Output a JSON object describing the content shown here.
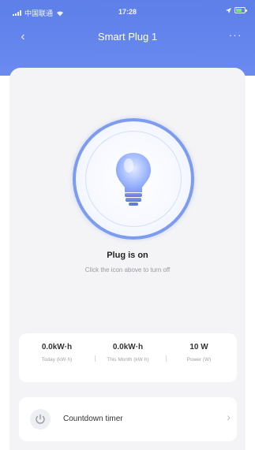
{
  "status_bar": {
    "carrier": "中国联通",
    "time": "17:28"
  },
  "nav": {
    "back_glyph": "‹",
    "title": "Smart Plug 1",
    "more_glyph": "···"
  },
  "device": {
    "status_text": "Plug is on",
    "hint_text": "Click the icon above to turn off",
    "icon": "light-bulb-icon",
    "accent_color": "#7d9cf0"
  },
  "stats": [
    {
      "value": "0.0kW·h",
      "label": "Today (kW·h)"
    },
    {
      "value": "0.0kW·h",
      "label": "This Month (kW·h)"
    },
    {
      "value": "10 W",
      "label": "Power (W)"
    }
  ],
  "timer": {
    "label": "Countdown timer",
    "icon": "power-icon",
    "chevron": "›"
  },
  "colors": {
    "header": "#5d7fe8",
    "background": "#f4f4f6"
  }
}
